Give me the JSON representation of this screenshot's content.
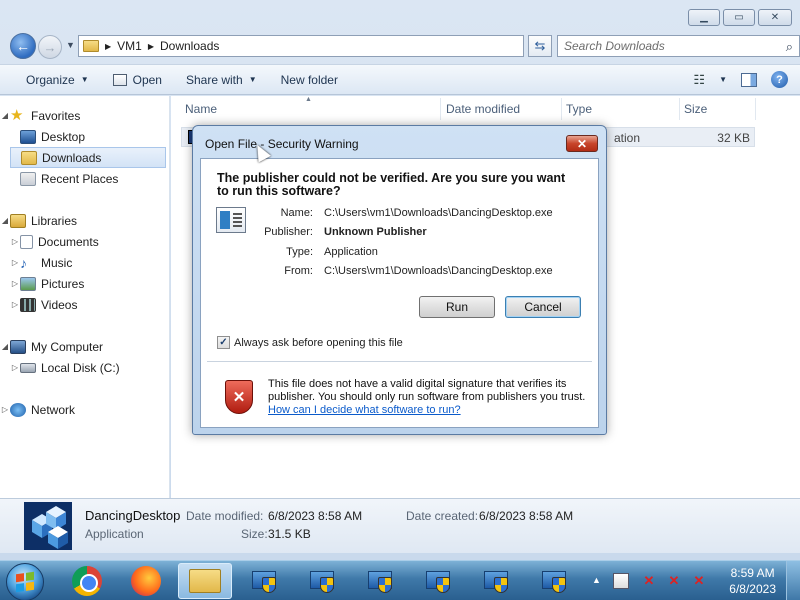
{
  "window": {
    "min_icon": "minimize-icon",
    "max_icon": "maximize-icon",
    "close_icon": "close-icon"
  },
  "address": {
    "segments": [
      "VM1",
      "Downloads"
    ],
    "search_placeholder": "Search Downloads"
  },
  "toolbar": {
    "organize": "Organize",
    "open": "Open",
    "share_with": "Share with",
    "new_folder": "New folder"
  },
  "navpane": {
    "favorites": "Favorites",
    "desktop": "Desktop",
    "downloads": "Downloads",
    "recent_places": "Recent Places",
    "libraries": "Libraries",
    "documents": "Documents",
    "music": "Music",
    "pictures": "Pictures",
    "videos": "Videos",
    "my_computer": "My Computer",
    "local_disk": "Local Disk (C:)",
    "network": "Network"
  },
  "columns": {
    "name": "Name",
    "date_modified": "Date modified",
    "type": "Type",
    "size": "Size"
  },
  "file_row": {
    "type_fragment": "ation",
    "size": "32 KB"
  },
  "details": {
    "name": "DancingDesktop",
    "type": "Application",
    "date_modified_label": "Date modified:",
    "date_modified": "6/8/2023 8:58 AM",
    "size_label": "Size:",
    "size": "31.5 KB",
    "date_created_label": "Date created:",
    "date_created": "6/8/2023 8:58 AM"
  },
  "dialog": {
    "title": "Open File - Security Warning",
    "heading": "The publisher could not be verified.  Are you sure you want to run this software?",
    "name_label": "Name:",
    "name_value": "C:\\Users\\vm1\\Downloads\\DancingDesktop.exe",
    "publisher_label": "Publisher:",
    "publisher_value": "Unknown Publisher",
    "type_label": "Type:",
    "type_value": "Application",
    "from_label": "From:",
    "from_value": "C:\\Users\\vm1\\Downloads\\DancingDesktop.exe",
    "run_button": "Run",
    "cancel_button": "Cancel",
    "checkbox_label": "Always ask before opening this file",
    "checkbox_checked": true,
    "warning_text": "This file does not have a valid digital signature that verifies its publisher.  You should only run software from publishers you trust.",
    "warning_link": "How can I decide what software to run?"
  },
  "taskbar": {
    "time": "8:59 AM",
    "date": "6/8/2023"
  },
  "colors": {
    "accent": "#2f6cc0",
    "close_red": "#c8452b",
    "link": "#0b5bcb"
  }
}
